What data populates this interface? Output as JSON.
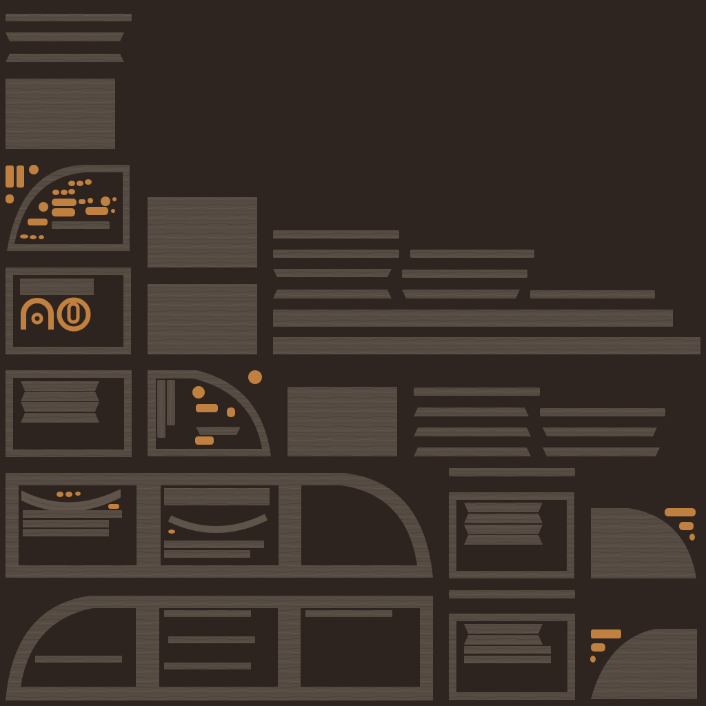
{
  "texture_atlas": {
    "background": "#2e2420",
    "colors": {
      "wood_light": "#5e544a",
      "wood_dark": "#463d36",
      "wood_grain": "#3b332d",
      "cavity": "#2d231f",
      "accent_orange": "#c9823f",
      "accent_orange_dark": "#8f5a2a"
    },
    "pieces": [
      "strip",
      "wood-panel",
      "quarter-round-frame",
      "square-frame",
      "arch-frame",
      "rounded-corner-panel",
      "decal-ornament"
    ]
  }
}
